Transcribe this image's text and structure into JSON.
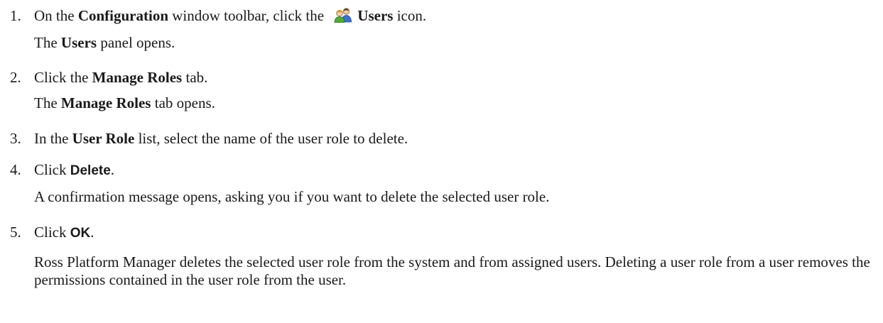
{
  "steps": [
    {
      "number": "1.",
      "parts": [
        "On the ",
        "Configuration",
        " window toolbar, click the ",
        "Users",
        " icon."
      ],
      "icon": "users-icon",
      "result": [
        "The ",
        "Users",
        " panel opens."
      ]
    },
    {
      "number": "2.",
      "parts": [
        "Click the ",
        "Manage Roles",
        " tab."
      ],
      "result": [
        "The ",
        "Manage Roles",
        " tab opens."
      ]
    },
    {
      "number": "3.",
      "parts": [
        "In the ",
        "User Role",
        " list, select the name of the user role to delete."
      ]
    },
    {
      "number": "4.",
      "parts": [
        "Click ",
        "Delete",
        "."
      ],
      "result": [
        "A confirmation message opens, asking you if you want to delete the selected user role."
      ]
    },
    {
      "number": "5.",
      "parts": [
        "Click ",
        "OK",
        "."
      ],
      "result": [
        "Ross Platform Manager deletes the selected user role from the system and from assigned users. Deleting a user role from a user removes the permissions contained in the user role from the user."
      ]
    }
  ]
}
